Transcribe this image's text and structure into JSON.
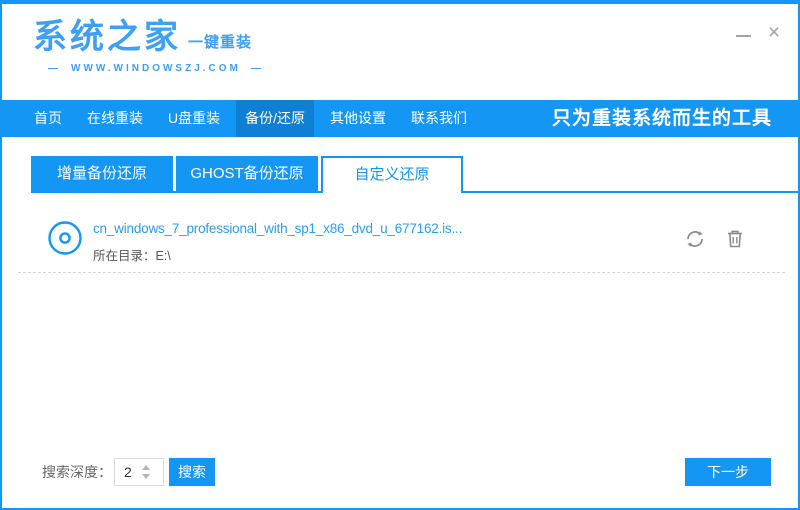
{
  "colors": {
    "accent": "#1496f5",
    "accent_dark": "#0f7fd4",
    "logo_blue": "#3da0f6",
    "link_blue": "#2b9df4"
  },
  "header": {
    "logo_text": "系统之家",
    "logo_subtitle": "一键重装",
    "website": "WWW.WINDOWSZJ.COM",
    "website_dash": "—"
  },
  "nav": {
    "items": [
      {
        "label": "首页",
        "active": false
      },
      {
        "label": "在线重装",
        "active": false
      },
      {
        "label": "U盘重装",
        "active": false
      },
      {
        "label": "备份/还原",
        "active": true
      },
      {
        "label": "其他设置",
        "active": false
      },
      {
        "label": "联系我们",
        "active": false
      }
    ],
    "slogan": "只为重装系统而生的工具"
  },
  "tabs": [
    {
      "label": "增量备份还原",
      "active": false
    },
    {
      "label": "GHOST备份还原",
      "active": false
    },
    {
      "label": "自定义还原",
      "active": true
    }
  ],
  "file_list": {
    "items": [
      {
        "filename": "cn_windows_7_professional_with_sp1_x86_dvd_u_677162.is...",
        "directory": "所在目录：E:\\"
      }
    ]
  },
  "footer": {
    "search_depth_label": "搜索深度：",
    "search_depth_value": "2",
    "search_button": "搜索",
    "next_button": "下一步"
  }
}
